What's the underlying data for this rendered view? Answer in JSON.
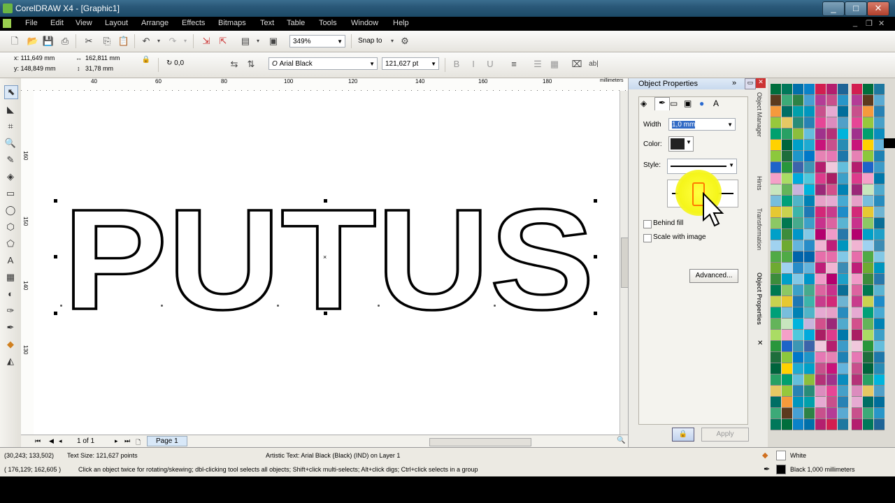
{
  "title": "CorelDRAW X4 - [Graphic1]",
  "window_buttons": [
    "_",
    "□",
    "✕"
  ],
  "menu": [
    "File",
    "Edit",
    "View",
    "Layout",
    "Arrange",
    "Effects",
    "Bitmaps",
    "Text",
    "Table",
    "Tools",
    "Window",
    "Help"
  ],
  "toolbar1": {
    "zoom": "349%",
    "snap_to": "Snap to"
  },
  "property_bar": {
    "x": "x: 111,649 mm",
    "y": "y: 148,849 mm",
    "width": "162,811 mm",
    "height": "31,78 mm",
    "angle": "0,0",
    "font": "Arial Black",
    "font_size": "121,627 pt"
  },
  "canvas": {
    "text": "PUTUS",
    "font_weight": "black",
    "outline_color": "#000000"
  },
  "ruler": {
    "h_labels": [
      "40",
      "60",
      "80",
      "100",
      "120",
      "140",
      "160",
      "180"
    ],
    "unit": "millimeters",
    "v_labels": [
      "160",
      "150",
      "140",
      "130"
    ]
  },
  "page_nav": {
    "position": "1 of 1",
    "page_tab": "Page 1"
  },
  "docker": {
    "title": "Object Properties",
    "width_label": "Width",
    "width_value": "1,0 mm",
    "color_label": "Color:",
    "style_label": "Style:",
    "behind_fill": "Behind fill",
    "scale_with_image": "Scale with image",
    "advanced_btn": "Advanced...",
    "apply_btn": "Apply",
    "side_tabs": [
      "Object Manager",
      "Hints",
      "Transformation",
      "Object Properties"
    ]
  },
  "status": {
    "coords1": "(30,243; 133,502)",
    "text_size": "Text Size: 121,627 points",
    "object_info": "Artistic Text: Arial Black (Black) (IND) on Layer 1",
    "coords2": "( 176,129; 162,605 )",
    "hint": "Click an object twice for rotating/skewing; dbl-clicking tool selects all objects; Shift+click multi-selects; Alt+click digs; Ctrl+click selects in a group",
    "fill_label": "White",
    "outline_label": "Black  1,000 millimeters"
  },
  "colors": {
    "highlight": "#f5f51a",
    "palette_left": [
      "#006e3c",
      "#5c3a1e",
      "#f59a3c",
      "#96c83c",
      "#00a06e",
      "#ffd200",
      "#8cc83c",
      "#1e64c8",
      "#f5a0c8",
      "#c8e6be",
      "#78bedc",
      "#e6c832",
      "#8cc864",
      "#00a0c8",
      "#a0d2f0",
      "#50aa46",
      "#6eaa32",
      "#3c8c3c",
      "#007850",
      "#c8d250",
      "#00a078",
      "#64b45a",
      "#aadc64",
      "#28963c",
      "#1e6e3c",
      "#00643c",
      "#28a064",
      "#e6c864",
      "#006e64",
      "#3caa78",
      "#00785a"
    ],
    "palette_mid1": [
      "#0070aa",
      "#2d8246",
      "#00a0aa",
      "#288c78",
      "#8cbe3c",
      "#00a0c8",
      "#1e96c8",
      "#3c64aa",
      "#00aadc",
      "#c8b4dc",
      "#50b4c8",
      "#3cb4aa",
      "#46aa8c",
      "#0096c8",
      "#64b4dc",
      "#0064aa",
      "#288cc8",
      "#82c8e6",
      "#3ca0c8",
      "#1e78b4",
      "#0082b4",
      "#00b4dc",
      "#50c8dc",
      "#3c96b4",
      "#0078c8",
      "#1eaad2",
      "#64bedc",
      "#2882b4",
      "#0096be",
      "#46a0d2",
      "#0a82c8"
    ],
    "palette_mid2": [
      "#d21e50",
      "#b43c96",
      "#c8508c",
      "#e64696",
      "#a0328c",
      "#c8147a",
      "#e682b4",
      "#b41e6e",
      "#dc3c8c",
      "#9b2878",
      "#e6a0c8",
      "#d22878",
      "#c8328c",
      "#b4006e",
      "#f0b4d2",
      "#e66eaa",
      "#be1e78",
      "#f09ac8",
      "#dc64a0",
      "#c83c8c",
      "#e6aad2",
      "#d2508c",
      "#aa1e64",
      "#f0c8dc",
      "#e678b4",
      "#c8508c",
      "#b43278",
      "#dc8cbe",
      "#e6aad2",
      "#c8508c",
      "#b41e6e"
    ],
    "palette_right": [
      "#1e6496",
      "#2896c8",
      "#006e9b",
      "#50a0c8",
      "#00b4dc",
      "#288cb4",
      "#1e78aa",
      "#64bedc",
      "#3ca0c8",
      "#0082b4",
      "#46aad2",
      "#1e8cc8",
      "#5ab4d2",
      "#2878aa",
      "#0096be",
      "#82c8e6",
      "#3c8cb4",
      "#1ea0c8",
      "#0a6e96",
      "#6eb4d2",
      "#288cbe",
      "#50aacd",
      "#0078aa",
      "#3c9bc8",
      "#1e82b4",
      "#64b4dc",
      "#0a8cbe",
      "#46a0c8",
      "#2882b4",
      "#5aaad2",
      "#1e78a0"
    ]
  }
}
